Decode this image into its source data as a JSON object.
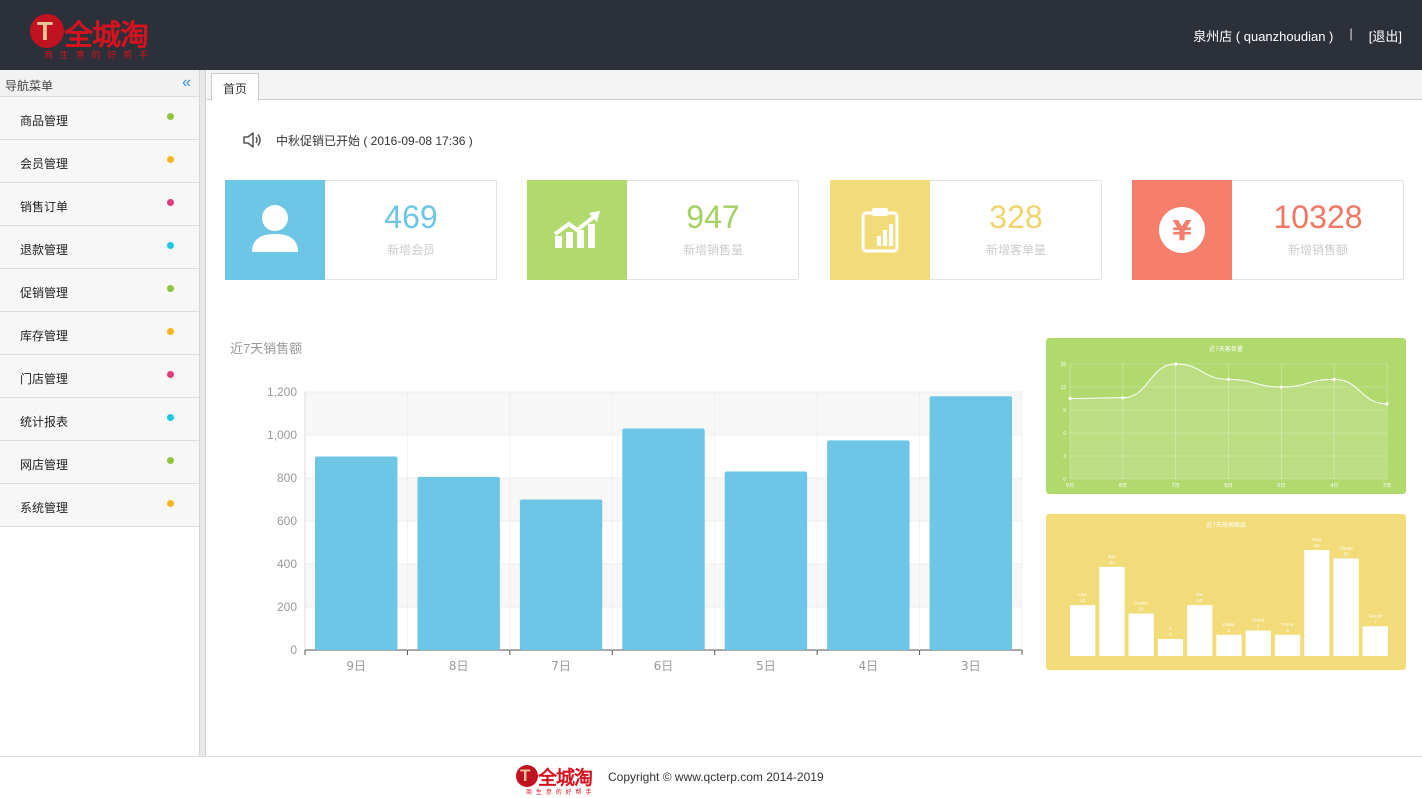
{
  "header": {
    "logo_text": "全城淘",
    "logo_slogan": "商 生 意 的 好 帮 手",
    "store": "泉州店 ( quanzhoudian )",
    "separator": "|",
    "logout": "[退出]"
  },
  "sidebar": {
    "title": "导航菜单",
    "collapse_icon": "double-chevron-left-icon",
    "items": [
      {
        "label": "商品管理",
        "dot_color": "#8cc63f"
      },
      {
        "label": "会员管理",
        "dot_color": "#f5b51e"
      },
      {
        "label": "销售订单",
        "dot_color": "#e23c7d"
      },
      {
        "label": "退款管理",
        "dot_color": "#1fc7e0"
      },
      {
        "label": "促销管理",
        "dot_color": "#8cc63f"
      },
      {
        "label": "库存管理",
        "dot_color": "#f5b51e"
      },
      {
        "label": "门店管理",
        "dot_color": "#e23c7d"
      },
      {
        "label": "统计报表",
        "dot_color": "#1fc7e0"
      },
      {
        "label": "网店管理",
        "dot_color": "#8cc63f"
      },
      {
        "label": "系统管理",
        "dot_color": "#f5b51e"
      }
    ]
  },
  "tabs": [
    {
      "label": "首页"
    }
  ],
  "notice": {
    "icon": "speaker-icon",
    "text": "中秋促销已开始 ( 2016-09-08 17:36 )"
  },
  "stats": [
    {
      "value": "469",
      "label": "新增会员",
      "icon": "user-icon",
      "color": "#6ec6e6",
      "num_color": "#6ec6e6"
    },
    {
      "value": "947",
      "label": "新增销售量",
      "icon": "trend-up-icon",
      "color": "#b0d96e",
      "num_color": "#a3d162"
    },
    {
      "value": "328",
      "label": "新增客单量",
      "icon": "clipboard-chart-icon",
      "color": "#f2dc7a",
      "num_color": "#f2d46e"
    },
    {
      "value": "10328",
      "label": "新增销售额",
      "icon": "yen-icon",
      "color": "#f57f6a",
      "num_color": "#f07761"
    }
  ],
  "main_chart": {
    "title": "近7天销售额",
    "bar_color": "#6ec6e6"
  },
  "chart_data": [
    {
      "type": "bar",
      "title": "近7天销售额",
      "categories": [
        "9日",
        "8日",
        "7日",
        "6日",
        "5日",
        "4日",
        "3日"
      ],
      "values": [
        900,
        805,
        700,
        1030,
        830,
        975,
        1180
      ],
      "ylim": [
        0,
        1200
      ],
      "yticks": [
        "0",
        "200",
        "400",
        "600",
        "800",
        "1,000",
        "1,200"
      ],
      "grid": true
    },
    {
      "type": "line",
      "title": "近7天客单量",
      "categories": [
        "9日",
        "8日",
        "7日",
        "6日",
        "5日",
        "4日",
        "3日"
      ],
      "values": [
        10.5,
        10.6,
        15,
        13,
        12,
        13,
        9.8
      ],
      "ylim": [
        0,
        15
      ],
      "yticks": [
        "0",
        "3",
        "6",
        "9",
        "12",
        "15"
      ],
      "color": "#ffffff"
    },
    {
      "type": "bar",
      "title": "近7天热销商品",
      "categories": [
        "Line",
        "Bar",
        "Scatter",
        "K",
        "Pie",
        "Radar",
        "Chord",
        "Force",
        "Map",
        "Gauge",
        "Funnel"
      ],
      "values": [
        12,
        21,
        10,
        4,
        12,
        5,
        6,
        5,
        25,
        23,
        7
      ],
      "color": "#ffffff"
    }
  ],
  "footer": {
    "logo_text": "全城淘",
    "logo_slogan": "商 生 意 的 好 帮 手",
    "copyright": "Copyright ©  www.qcterp.com 2014-2019"
  }
}
